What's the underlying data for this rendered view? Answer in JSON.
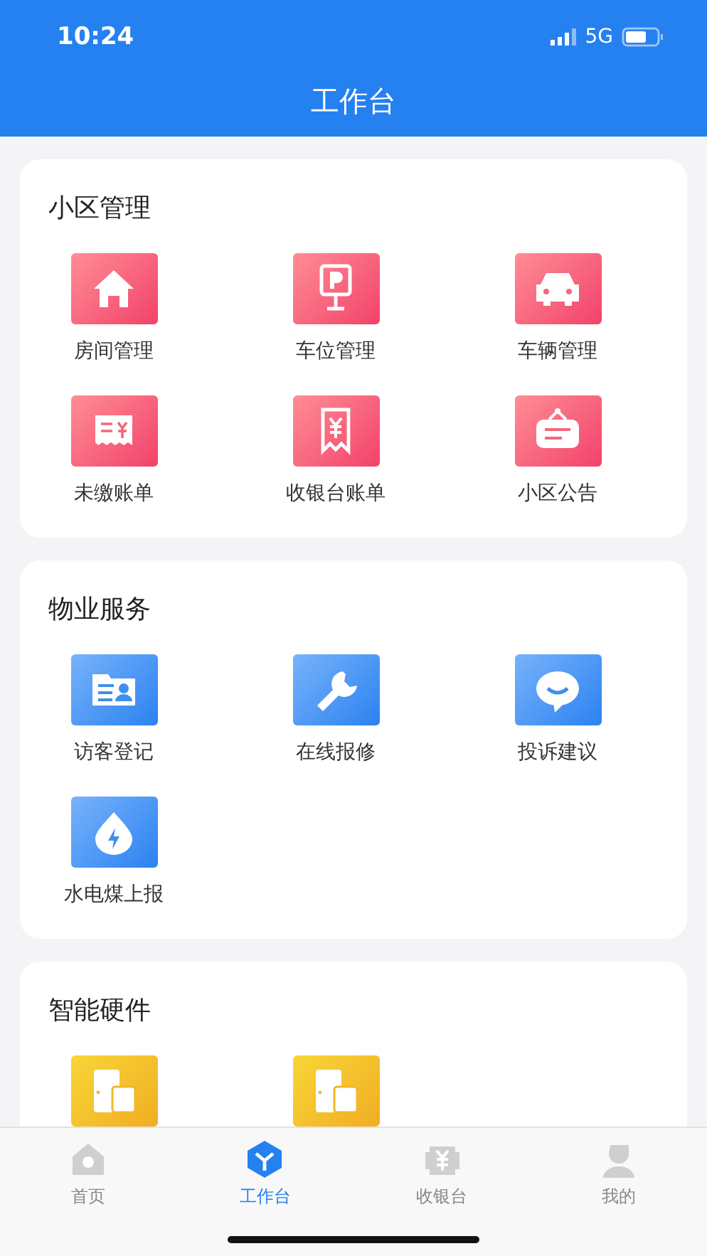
{
  "status_bar": {
    "time": "10:24",
    "network": "5G"
  },
  "header": {
    "title": "工作台"
  },
  "sections": [
    {
      "title": "小区管理",
      "items": [
        {
          "kind": "house",
          "label": "房间管理"
        },
        {
          "kind": "parking",
          "label": "车位管理"
        },
        {
          "kind": "car",
          "label": "车辆管理"
        },
        {
          "kind": "bill",
          "label": "未缴账单"
        },
        {
          "kind": "receipt",
          "label": "收银台账单"
        },
        {
          "kind": "sign",
          "label": "小区公告"
        }
      ]
    },
    {
      "title": "物业服务",
      "items": [
        {
          "kind": "card",
          "label": "访客登记"
        },
        {
          "kind": "wrench",
          "label": "在线报修"
        },
        {
          "kind": "chat",
          "label": "投诉建议"
        },
        {
          "kind": "drop",
          "label": "水电煤上报"
        }
      ]
    },
    {
      "title": "智能硬件",
      "items": [
        {
          "kind": "door"
        },
        {
          "kind": "door"
        }
      ]
    }
  ],
  "tab_bar": [
    {
      "kind": "home",
      "label": "首页",
      "selected": false
    },
    {
      "kind": "cube",
      "label": "工作台",
      "selected": true
    },
    {
      "kind": "cashier",
      "label": "收银台",
      "selected": false
    },
    {
      "kind": "person",
      "label": "我的",
      "selected": false
    }
  ]
}
